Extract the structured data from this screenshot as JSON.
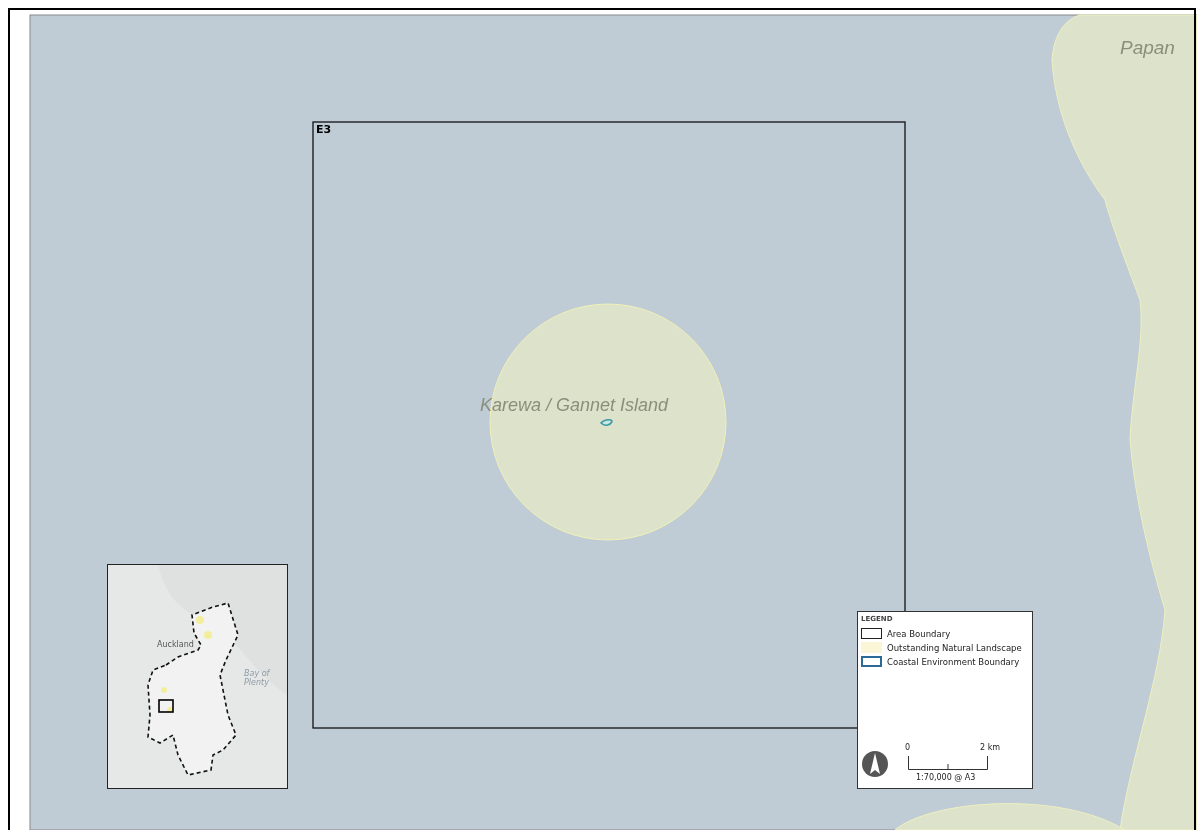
{
  "map": {
    "area_label": "E3",
    "place_labels": [
      {
        "text": "Karewa / Gannet Island",
        "kind": "island"
      },
      {
        "text": "Papan",
        "kind": "coast"
      }
    ]
  },
  "inset": {
    "labels": [
      {
        "text": "Auckland",
        "kind": "city"
      },
      {
        "text": "Bay of Plenty",
        "kind": "water"
      }
    ]
  },
  "legend": {
    "title": "LEGEND",
    "items": [
      {
        "label": "Area Boundary",
        "kind": "outline"
      },
      {
        "label": "Outstanding Natural Landscape",
        "kind": "fill"
      },
      {
        "label": "Coastal Environment Boundary",
        "kind": "coastal"
      }
    ],
    "scale": {
      "start": "0",
      "end": "2 km",
      "ratio": "1:70,000 @ A3"
    }
  }
}
